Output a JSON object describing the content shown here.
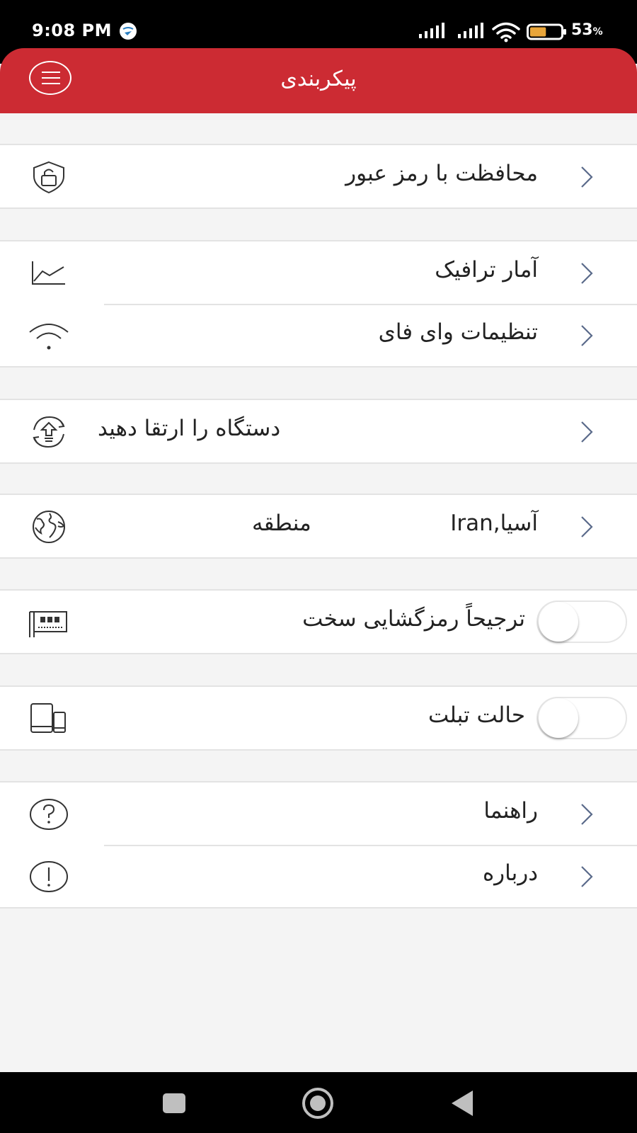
{
  "status_bar": {
    "time": "9:08 PM",
    "battery_percent": "53",
    "percent_sign": "%",
    "battery_level": 0.53,
    "icons": [
      "app-notification-icon",
      "cell-signal-icon",
      "cell-signal-icon",
      "wifi-icon",
      "battery-icon"
    ]
  },
  "header": {
    "title": "پیکربندی",
    "menu_icon": "hamburger-menu-icon",
    "color": "#cc2b33"
  },
  "rows": {
    "password_protection": {
      "label": "محافظت با رمز عبور",
      "icon": "shield-lock-icon"
    },
    "traffic_stats": {
      "label": "آمار ترافیک",
      "icon": "line-chart-icon"
    },
    "wifi_settings": {
      "label": "تنظیمات وای فای",
      "icon": "wifi-icon"
    },
    "upgrade_device": {
      "label": "دستگاه را ارتقا دهید",
      "icon": "upgrade-arrow-icon"
    },
    "region": {
      "label": "منطقه",
      "value": "آسیا,Iran",
      "icon": "globe-icon"
    },
    "hardware_decoding": {
      "label": "ترجیحاً رمزگشایی سخت",
      "icon": "hardware-chip-icon",
      "enabled": false
    },
    "tablet_mode": {
      "label": "حالت تبلت",
      "icon": "tablet-icon",
      "enabled": false
    },
    "help": {
      "label": "راهنما",
      "icon": "question-circle-icon"
    },
    "about": {
      "label": "درباره",
      "icon": "info-circle-icon"
    }
  },
  "nav_bar": {
    "icons": [
      "recent-apps-icon",
      "home-icon",
      "back-icon"
    ]
  }
}
